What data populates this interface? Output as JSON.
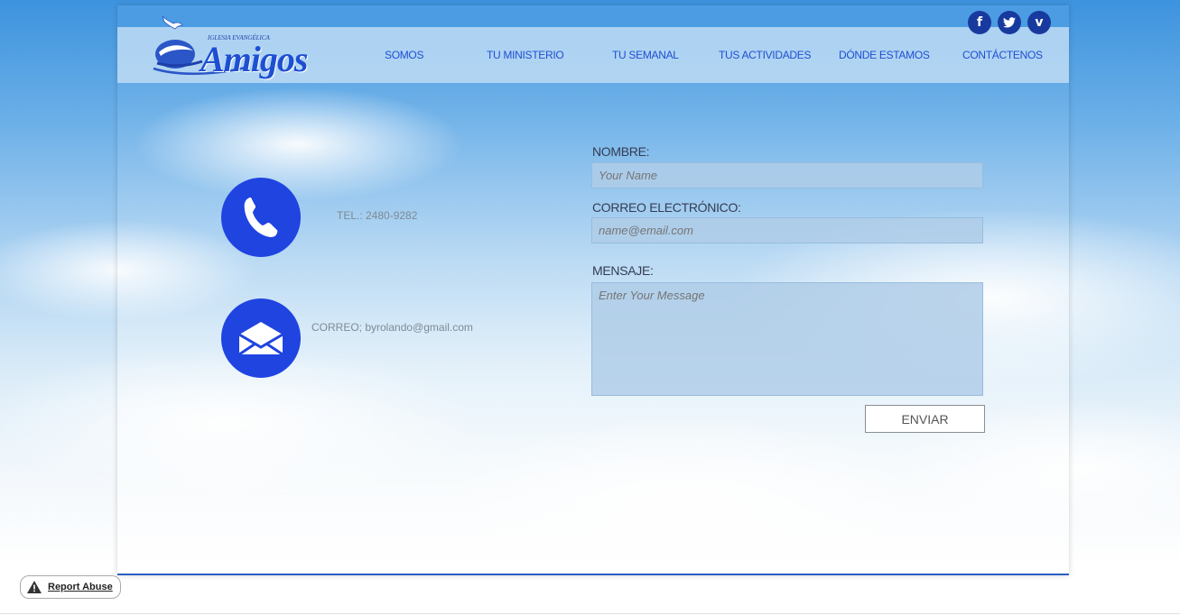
{
  "header": {
    "logo_small_text": "IGLESIA EVANGÉLICA",
    "logo_text": "Amigos",
    "nav": [
      {
        "label": "SOMOS"
      },
      {
        "label": "TU MINISTERIO"
      },
      {
        "label": "TU SEMANAL"
      },
      {
        "label": "TUS ACTIVIDADES"
      },
      {
        "label": "DÓNDE ESTAMOS"
      },
      {
        "label": "CONTÁCTENOS"
      }
    ],
    "social": [
      {
        "icon": "facebook-icon",
        "glyph": "f"
      },
      {
        "icon": "twitter-icon",
        "glyph": "t"
      },
      {
        "icon": "vimeo-icon",
        "glyph": "v"
      }
    ]
  },
  "contact": {
    "phone_text": "TEL.: 2480-9282",
    "email_text": "CORREO; byrolando@gmail.com"
  },
  "form": {
    "name_label": "NOMBRE:",
    "name_placeholder": "Your Name",
    "email_label": "CORREO ELECTRÓNICO:",
    "email_placeholder": "name@email.com",
    "message_label": "MENSAJE:",
    "message_placeholder": "Enter Your Message",
    "submit_label": "ENVIAR"
  },
  "footer": {
    "report_label": "Report Abuse"
  },
  "colors": {
    "accent": "#1f44e0",
    "nav_text": "#1e4fd2",
    "social": "#183a9e"
  }
}
